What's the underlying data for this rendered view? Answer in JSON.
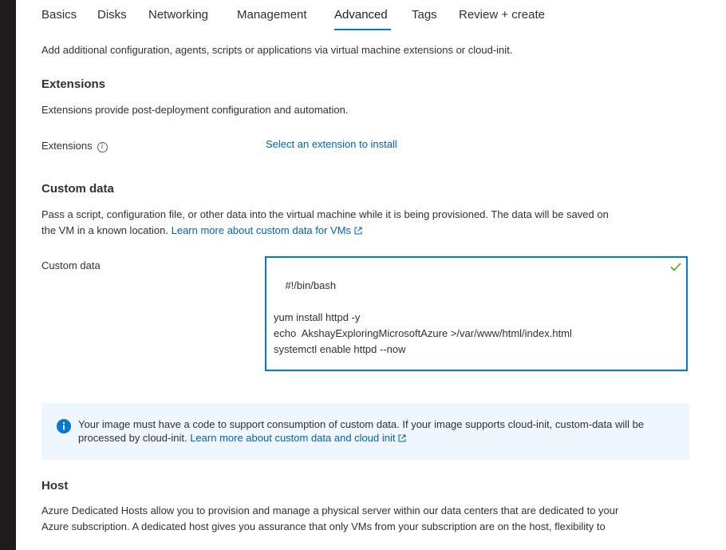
{
  "tabs": [
    {
      "label": "Basics"
    },
    {
      "label": "Disks"
    },
    {
      "label": "Networking"
    },
    {
      "label": "Management"
    },
    {
      "label": "Advanced",
      "active": true
    },
    {
      "label": "Tags"
    },
    {
      "label": "Review + create"
    }
  ],
  "intro": "Add additional configuration, agents, scripts or applications via virtual machine extensions or cloud-init.",
  "extensions": {
    "title": "Extensions",
    "description": "Extensions provide post-deployment configuration and automation.",
    "field_label": "Extensions",
    "action_link": "Select an extension to install"
  },
  "custom_data": {
    "title": "Custom data",
    "description_line1": "Pass a script, configuration file, or other data into the virtual machine while it is being provisioned. The data will be saved on",
    "description_line2": "the VM in a known location.",
    "learn_more": "Learn more about custom data for VMs",
    "field_label": "Custom data",
    "value": "#!/bin/bash\n\nyum install httpd -y\necho  AkshayExploringMicrosoftAzure >/var/www/html/index.html\nsystemctl enable httpd --now"
  },
  "info_banner": {
    "line1": "Your image must have a code to support consumption of custom data. If your image supports cloud-init, custom-data will be",
    "line2": "processed by cloud-init.",
    "learn_more": "Learn more about custom data and cloud init"
  },
  "host": {
    "title": "Host",
    "line1": "Azure Dedicated Hosts allow you to provision and manage a physical server within our data centers that are dedicated to your",
    "line2": "Azure subscription. A dedicated host gives you assurance that only VMs from your subscription are on the host, flexibility to"
  },
  "colors": {
    "accent": "#0078d4",
    "link": "#0064b4",
    "success": "#57a300",
    "info_bg": "#f0f6fd"
  }
}
